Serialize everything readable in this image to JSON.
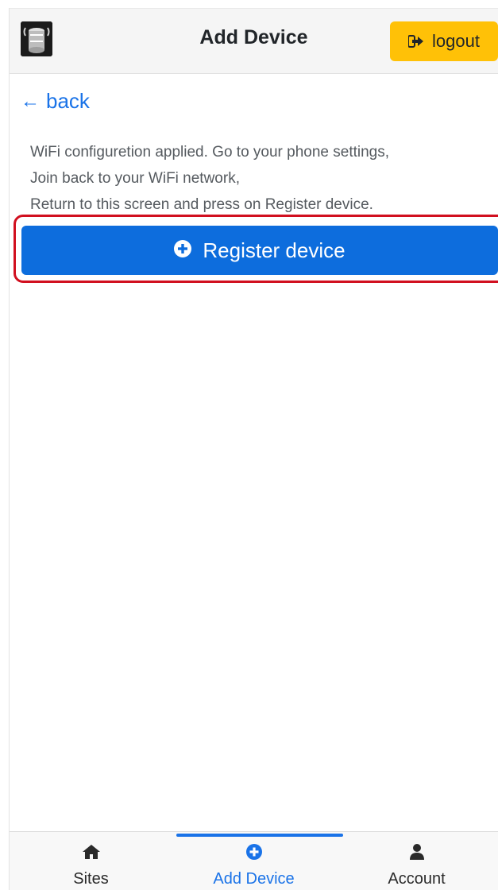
{
  "header": {
    "title": "Add Device",
    "logout_label": "logout",
    "logo_icon": "device-logo-icon",
    "logout_icon": "sign-out-icon"
  },
  "content": {
    "back_label": "back",
    "back_icon": "arrow-left-icon",
    "info_lines": [
      "WiFi configuretion applied. Go to your phone settings,",
      "Join back to your WiFi network,",
      "Return to this screen and press on Register device."
    ],
    "register_label": "Register device",
    "register_icon": "plus-circle-icon"
  },
  "bottom_nav": {
    "items": [
      {
        "label": "Sites",
        "icon": "home-icon",
        "active": false
      },
      {
        "label": "Add Device",
        "icon": "plus-circle-icon",
        "active": true
      },
      {
        "label": "Account",
        "icon": "user-icon",
        "active": false
      }
    ]
  },
  "colors": {
    "accent": "#1a73e8",
    "primary_button": "#0d6ddd",
    "logout_button": "#ffc107",
    "highlight_border": "#d10f1f"
  }
}
